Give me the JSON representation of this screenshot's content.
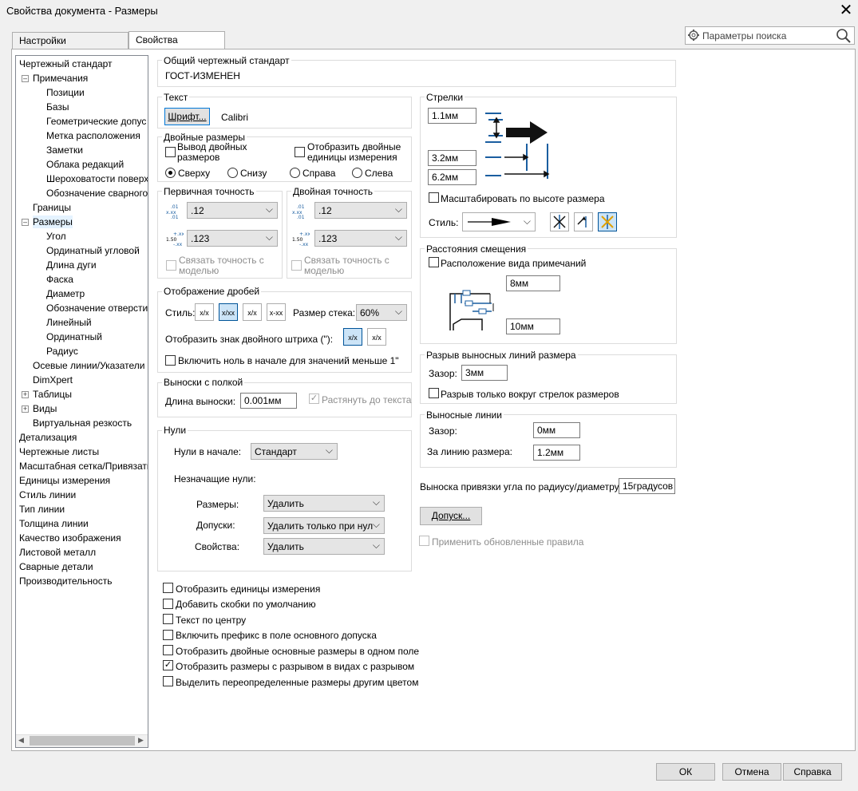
{
  "window": {
    "title": "Свойства документа - Размеры",
    "close": "✕"
  },
  "tabs": [
    "Настройки пользователя",
    "Свойства документа"
  ],
  "search": {
    "placeholder": "Параметры поиска"
  },
  "tree": [
    "Чертежный стандарт",
    "Примечания",
    "Позиции",
    "Базы",
    "Геометрические допус",
    "Метка расположения",
    "Заметки",
    "Облака редакций",
    "Шероховатости поверх",
    "Обозначение сварного",
    "Границы",
    "Размеры",
    "Угол",
    "Ординатный угловой",
    "Длина дуги",
    "Фаска",
    "Диаметр",
    "Обозначение отверсти",
    "Линейный",
    "Ординатный",
    "Радиус",
    "Осевые линии/Указатели",
    "DimXpert",
    "Таблицы",
    "Виды",
    "Виртуальная резкость",
    "Детализация",
    "Чертежные листы",
    "Масштабная сетка/Привязать",
    "Единицы измерения",
    "Стиль линии",
    "Тип линии",
    "Толщина линии",
    "Качество изображения",
    "Листовой металл",
    "Сварные детали",
    "Производительность"
  ],
  "standard": {
    "label": "Общий чертежный стандарт",
    "value": "ГОСТ-ИЗМЕНЕН"
  },
  "text": {
    "label": "Текст",
    "font_button": "Шрифт...",
    "font_name": "Calibri"
  },
  "dual": {
    "label": "Двойные размеры",
    "show_dual": "Вывод двойных размеров",
    "show_units": "Отобразить двойные единицы измерения",
    "radios": [
      "Сверху",
      "Снизу",
      "Справа",
      "Слева"
    ],
    "selected": "Сверху"
  },
  "primary_precision": {
    "label": "Первичная точность",
    "value1": ".12",
    "value2": ".123",
    "link": "Связать точность с моделью"
  },
  "dual_precision": {
    "label": "Двойная точность",
    "value1": ".12",
    "value2": ".123",
    "link": "Связать точность с моделью"
  },
  "fractions": {
    "label": "Отображение дробей",
    "style_label": "Стиль:",
    "style_icons": [
      "x/x",
      "x/xx",
      "x/x",
      "x-xx"
    ],
    "stack_label": "Размер стека:",
    "stack_value": "60%",
    "double_prime_label": "Отобразить знак двойного штриха (\"):",
    "leading_zero": "Включить ноль в начале для значений меньше 1\""
  },
  "leaders": {
    "label": "Выноски с полкой",
    "length_label": "Длина выноски:",
    "length_value": "0.001мм",
    "stretch": "Растянуть до текста"
  },
  "zeros": {
    "label": "Нули",
    "leading_label": "Нули в начале:",
    "leading_value": "Стандарт",
    "trailing_label": "Незначащие нули:",
    "dims_label": "Размеры:",
    "dims_value": "Удалить",
    "tol_label": "Допуски:",
    "tol_value": "Удалить только при нул",
    "props_label": "Свойства:",
    "props_value": "Удалить"
  },
  "bottom_checks": [
    {
      "label": "Отобразить единицы измерения",
      "checked": false
    },
    {
      "label": "Добавить скобки по умолчанию",
      "checked": false
    },
    {
      "label": "Текст по центру",
      "checked": false
    },
    {
      "label": "Включить префикс в поле основного допуска",
      "checked": false
    },
    {
      "label": "Отобразить двойные основные размеры в одном поле",
      "checked": false
    },
    {
      "label": "Отобразить размеры с разрывом в видах с разрывом",
      "checked": true
    },
    {
      "label": "Выделить переопределенные размеры другим цветом",
      "checked": false
    }
  ],
  "arrows": {
    "label": "Стрелки",
    "v1": "1.1мм",
    "v2": "3.2мм",
    "v3": "6.2мм",
    "scale": "Масштабировать по высоте размера",
    "style_label": "Стиль:"
  },
  "offset": {
    "label": "Расстояния смещения",
    "check": "Расположение вида примечаний",
    "v1": "8мм",
    "v2": "10мм"
  },
  "break": {
    "label": "Разрыв выносных линий размера",
    "gap_label": "Зазор:",
    "gap_value": "3мм",
    "only_arrows": "Разрыв только вокруг стрелок размеров"
  },
  "ext_lines": {
    "label": "Выносные линии",
    "gap_label": "Зазор:",
    "gap_value": "0мм",
    "beyond_label": "За линию размера:",
    "beyond_value": "1.2мм"
  },
  "radial": {
    "label": "Выноска привязки угла по радиусу/диаметру:",
    "value": "15градусов"
  },
  "tolerance_button": "Допуск...",
  "apply_rules": "Применить обновленные правила",
  "footer": {
    "ok": "ОК",
    "cancel": "Отмена",
    "help": "Справка"
  }
}
